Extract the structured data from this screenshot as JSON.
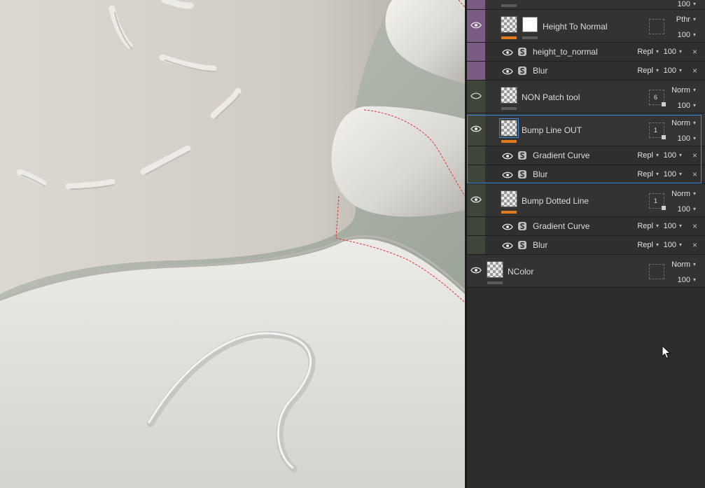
{
  "colors": {
    "accent": "#3d8be0",
    "strip_purple": "#7a5b84",
    "strip_green": "#3e463a",
    "bar_orange": "#e07a1c",
    "bar_gray": "#5a5a5a",
    "path_red": "#e23333"
  },
  "icons": {
    "visibility": "eye-icon",
    "hidden": "eye-closed-icon",
    "effect": "substance-icon",
    "dropdown": "chevron-down-icon",
    "remove": "close-icon",
    "cursor": "mouse-cursor-icon"
  },
  "layers": {
    "top_partial": {
      "opacity": "100"
    },
    "height_to_normal": {
      "name": "Height To Normal",
      "blend": "Pthr",
      "opacity": "100",
      "effects": [
        {
          "name": "height_to_normal",
          "blend": "Repl",
          "opacity": "100"
        },
        {
          "name": "Blur",
          "blend": "Repl",
          "opacity": "100"
        }
      ]
    },
    "non_patch_tool": {
      "name": "NON Patch tool",
      "blend": "Norm",
      "opacity": "100",
      "mask_count": "6"
    },
    "bump_line_out": {
      "name": "Bump Line OUT",
      "blend": "Norm",
      "opacity": "100",
      "mask_count": "1",
      "effects": [
        {
          "name": "Gradient Curve",
          "blend": "Repl",
          "opacity": "100"
        },
        {
          "name": "Blur",
          "blend": "Repl",
          "opacity": "100"
        }
      ]
    },
    "bump_dotted_line": {
      "name": "Bump Dotted Line",
      "blend": "Norm",
      "opacity": "100",
      "mask_count": "1",
      "effects": [
        {
          "name": "Gradient Curve",
          "blend": "Repl",
          "opacity": "100"
        },
        {
          "name": "Blur",
          "blend": "Repl",
          "opacity": "100"
        }
      ]
    },
    "ncolor": {
      "name": "NColor",
      "blend": "Norm",
      "opacity": "100"
    }
  },
  "ui": {
    "close_glyph": "×",
    "caret_glyph": "▾"
  }
}
